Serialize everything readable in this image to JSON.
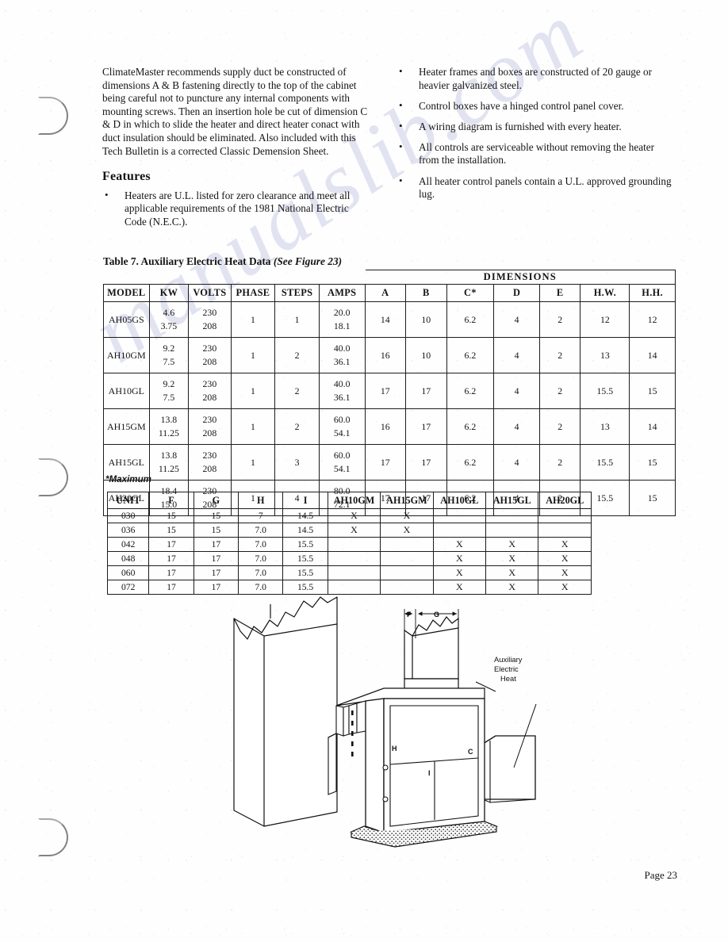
{
  "body": {
    "left_paragraph": "ClimateMaster recommends supply duct be constructed of dimensions A & B fastening directly to the top of the cabinet being careful not to puncture any internal components with mounting screws. Then an insertion hole be cut of dimension C & D in which to slide the heater and direct heater conact with duct insulation should be eliminated. Also included with this Tech Bulletin is a corrected Classic Demension Sheet.",
    "features_heading": "Features",
    "left_bullets": [
      "Heaters are U.L. listed for zero clearance and meet all applicable requirements of the 1981 National Electric Code (N.E.C.)."
    ],
    "right_bullets": [
      "Heater frames and boxes are constructed of 20 gauge or heavier galvanized steel.",
      "Control boxes have a hinged control panel cover.",
      "A wiring diagram is furnished with every heater.",
      "All controls are serviceable without removing the heater from the installation.",
      "All heater control panels contain a U.L. approved grounding lug."
    ],
    "bullet_glyph": "•"
  },
  "table7": {
    "caption_main": "Table 7. Auxiliary Electric Heat Data ",
    "caption_italic": "(See Figure 23)",
    "group_header": "DIMENSIONS",
    "headers": [
      "MODEL",
      "KW",
      "VOLTS",
      "PHASE",
      "STEPS",
      "AMPS",
      "A",
      "B",
      "C*",
      "D",
      "E",
      "H.W.",
      "H.H."
    ],
    "rows": [
      {
        "model": "AH05GS",
        "kw": [
          "4.6",
          "3.75"
        ],
        "volts": [
          "230",
          "208"
        ],
        "phase": "1",
        "steps": "1",
        "amps": [
          "20.0",
          "18.1"
        ],
        "a": "14",
        "b": "10",
        "c": "6.2",
        "d": "4",
        "e": "2",
        "hw": "12",
        "hh": "12"
      },
      {
        "model": "AH10GM",
        "kw": [
          "9.2",
          "7.5"
        ],
        "volts": [
          "230",
          "208"
        ],
        "phase": "1",
        "steps": "2",
        "amps": [
          "40.0",
          "36.1"
        ],
        "a": "16",
        "b": "10",
        "c": "6.2",
        "d": "4",
        "e": "2",
        "hw": "13",
        "hh": "14"
      },
      {
        "model": "AH10GL",
        "kw": [
          "9.2",
          "7.5"
        ],
        "volts": [
          "230",
          "208"
        ],
        "phase": "1",
        "steps": "2",
        "amps": [
          "40.0",
          "36.1"
        ],
        "a": "17",
        "b": "17",
        "c": "6.2",
        "d": "4",
        "e": "2",
        "hw": "15.5",
        "hh": "15"
      },
      {
        "model": "AH15GM",
        "kw": [
          "13.8",
          "11.25"
        ],
        "volts": [
          "230",
          "208"
        ],
        "phase": "1",
        "steps": "2",
        "amps": [
          "60.0",
          "54.1"
        ],
        "a": "16",
        "b": "17",
        "c": "6.2",
        "d": "4",
        "e": "2",
        "hw": "13",
        "hh": "14"
      },
      {
        "model": "AH15GL",
        "kw": [
          "13.8",
          "11.25"
        ],
        "volts": [
          "230",
          "208"
        ],
        "phase": "1",
        "steps": "3",
        "amps": [
          "60.0",
          "54.1"
        ],
        "a": "17",
        "b": "17",
        "c": "6.2",
        "d": "4",
        "e": "2",
        "hw": "15.5",
        "hh": "15"
      },
      {
        "model": "AH20GL",
        "kw": [
          "18.4",
          "15.0"
        ],
        "volts": [
          "230",
          "208"
        ],
        "phase": "1",
        "steps": "4",
        "amps": [
          "80.0",
          "72.1"
        ],
        "a": "17",
        "b": "17",
        "c": "6.2",
        "d": "4",
        "e": "2",
        "hw": "15.5",
        "hh": "15"
      }
    ],
    "footnote": "*Maximum"
  },
  "unit_table": {
    "headers": [
      "UNIT",
      "F",
      "G",
      "H",
      "I",
      "AH10GM",
      "AH15GM",
      "AH10GL",
      "AH15GL",
      "AH20GL"
    ],
    "rows": [
      {
        "unit": "030",
        "f": "15",
        "g": "15",
        "h": "7",
        "i": "14.5",
        "ah10gm": "X",
        "ah15gm": "X",
        "ah10gl": "",
        "ah15gl": "",
        "ah20gl": ""
      },
      {
        "unit": "036",
        "f": "15",
        "g": "15",
        "h": "7.0",
        "i": "14.5",
        "ah10gm": "X",
        "ah15gm": "X",
        "ah10gl": "",
        "ah15gl": "",
        "ah20gl": ""
      },
      {
        "unit": "042",
        "f": "17",
        "g": "17",
        "h": "7.0",
        "i": "15.5",
        "ah10gm": "",
        "ah15gm": "",
        "ah10gl": "X",
        "ah15gl": "X",
        "ah20gl": "X"
      },
      {
        "unit": "048",
        "f": "17",
        "g": "17",
        "h": "7.0",
        "i": "15.5",
        "ah10gm": "",
        "ah15gm": "",
        "ah10gl": "X",
        "ah15gl": "X",
        "ah20gl": "X"
      },
      {
        "unit": "060",
        "f": "17",
        "g": "17",
        "h": "7.0",
        "i": "15.5",
        "ah10gm": "",
        "ah15gm": "",
        "ah10gl": "X",
        "ah15gl": "X",
        "ah20gl": "X"
      },
      {
        "unit": "072",
        "f": "17",
        "g": "17",
        "h": "7.0",
        "i": "15.5",
        "ah10gm": "",
        "ah15gm": "",
        "ah10gl": "X",
        "ah15gl": "X",
        "ah20gl": "X"
      }
    ]
  },
  "figure": {
    "dimension_labels": {
      "f": "F",
      "g": "G",
      "h": "H",
      "i": "I",
      "c": "C"
    },
    "callout_line1": "Auxiliary",
    "callout_line2": "Electric",
    "callout_line3": "Heat"
  },
  "footer": {
    "page_number": "Page 23"
  },
  "watermark": {
    "text": "manualslib.com"
  }
}
